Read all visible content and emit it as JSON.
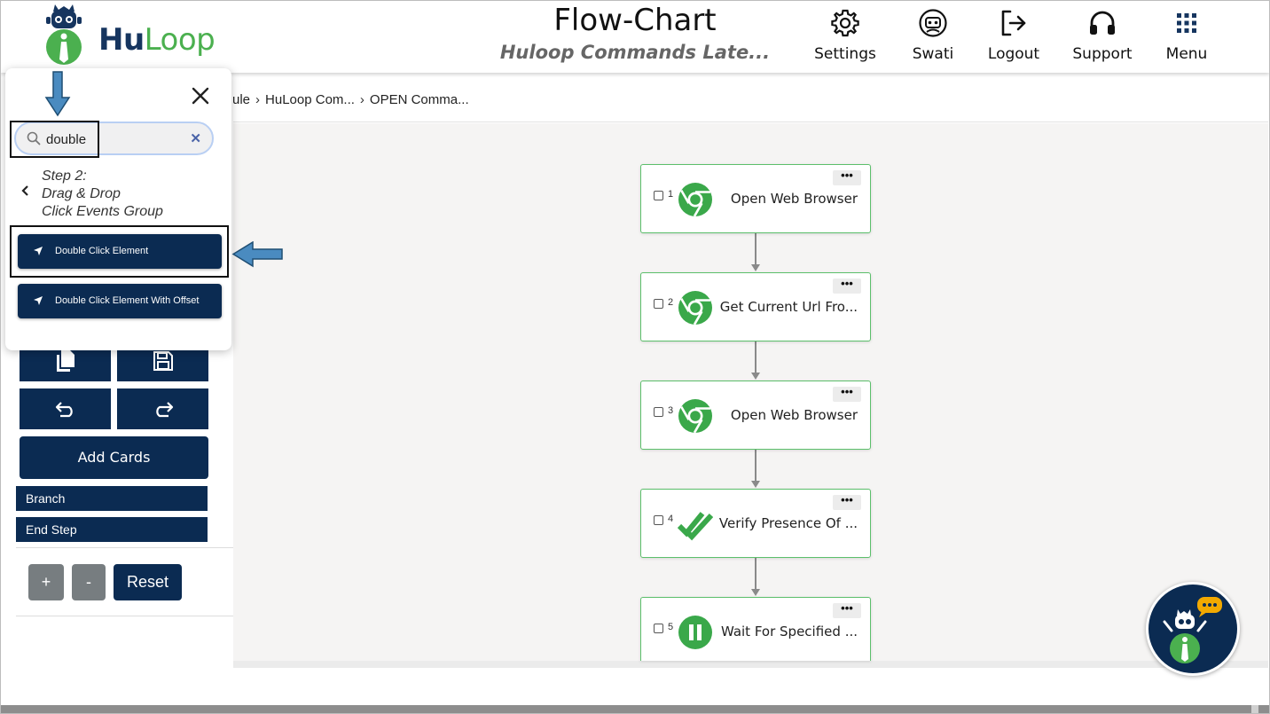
{
  "app": {
    "logo_text_bold": "Hu",
    "logo_text_light": "Loop",
    "title": "Flow-Chart",
    "subtitle": "Huloop Commands Late..."
  },
  "nav": {
    "settings": "Settings",
    "user": "Swati",
    "logout": "Logout",
    "support": "Support",
    "menu": "Menu"
  },
  "breadcrumb": [
    "ule",
    "HuLoop Com...",
    "OPEN Comma..."
  ],
  "search": {
    "value": "double"
  },
  "panel": {
    "step_line1": "Step 2:",
    "step_line2": "Drag & Drop",
    "step_line3": "Click Events Group",
    "commands": [
      {
        "label": "Double Click Element"
      },
      {
        "label": "Double Click Element With Offset"
      }
    ]
  },
  "toolbar": {
    "add_cards": "Add Cards",
    "branch": "Branch",
    "end_step": "End Step",
    "zoom_in": "+",
    "zoom_out": "-",
    "reset": "Reset"
  },
  "cards": [
    {
      "number": "1",
      "title": "Open Web Browser",
      "icon": "chrome-icon"
    },
    {
      "number": "2",
      "title": "Get Current Url Fro...",
      "icon": "chrome-icon"
    },
    {
      "number": "3",
      "title": "Open Web Browser",
      "icon": "chrome-icon"
    },
    {
      "number": "4",
      "title": "Verify Presence Of ...",
      "icon": "double-check-icon"
    },
    {
      "number": "5",
      "title": "Wait For Specified ...",
      "icon": "pause-icon"
    }
  ],
  "colors": {
    "brand_navy": "#0b2b52",
    "brand_green": "#4bb04f",
    "card_border": "#5cbf6b",
    "annotation_arrow": "#4a8bc0"
  }
}
